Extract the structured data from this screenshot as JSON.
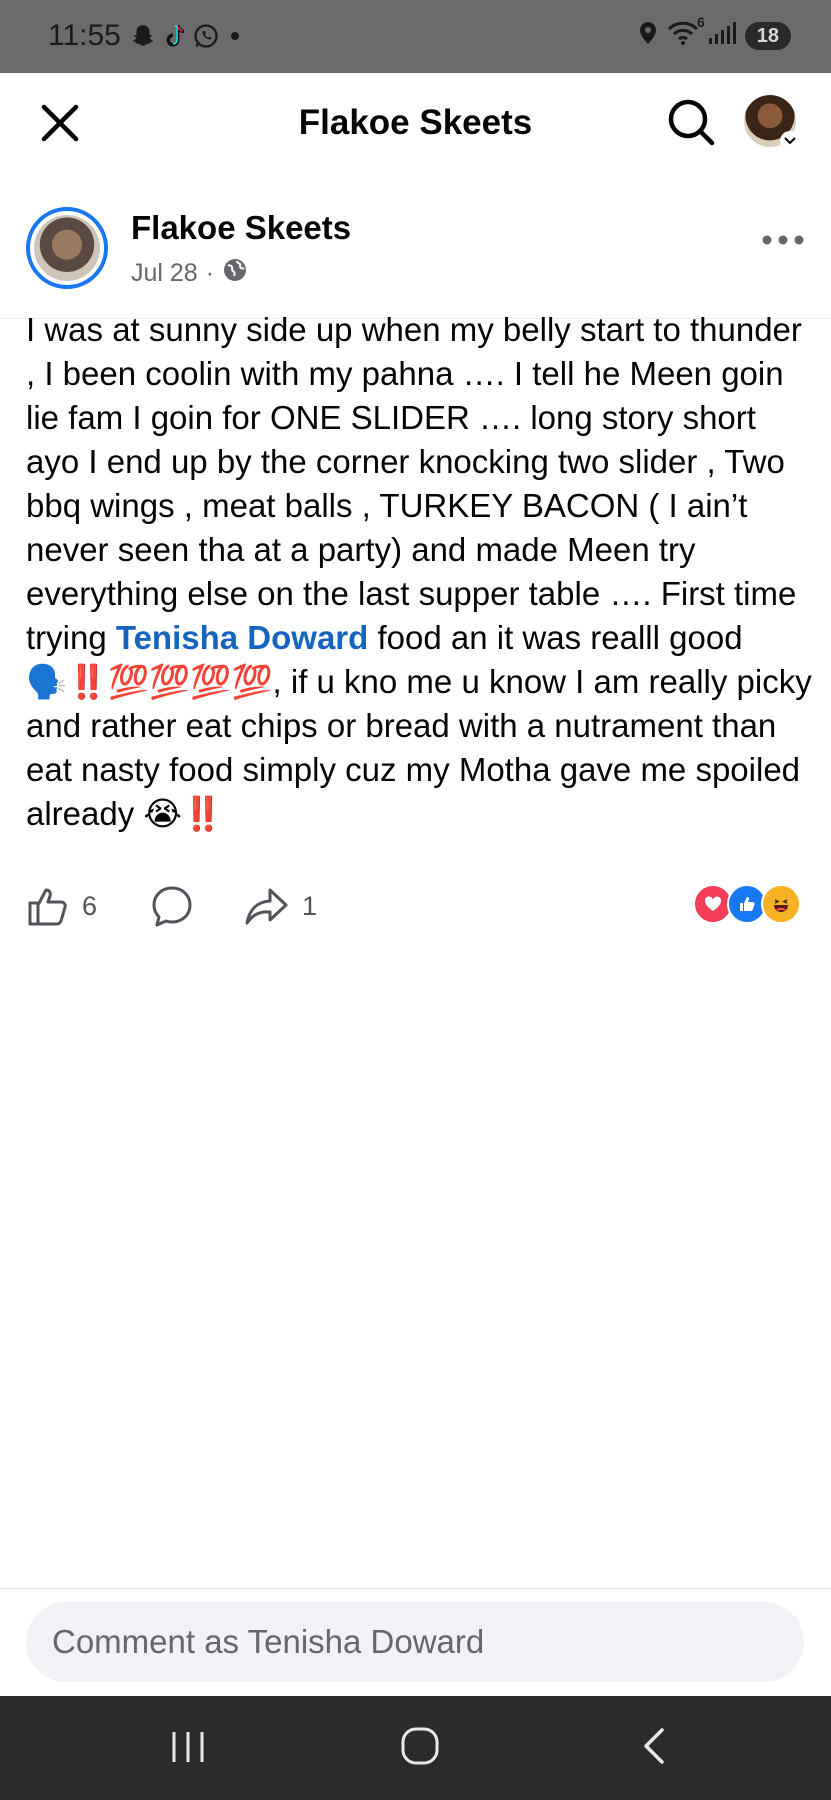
{
  "status_bar": {
    "time": "11:55",
    "notification_icons": [
      "snapchat-icon",
      "tiktok-icon",
      "whatsapp-icon",
      "dot-icon"
    ],
    "right_icons": [
      "location-icon",
      "wifi-icon",
      "signal-icon"
    ],
    "wifi_label": "6",
    "battery": "18"
  },
  "header": {
    "title": "Flakoe Skeets"
  },
  "post": {
    "author": "Flakoe Skeets",
    "date": "Jul 28",
    "separator": "·",
    "text_part1": "I was at sunny side up when my belly start to thunder , I been coolin with my pahna …. I tell he Meen goin lie fam I goin for ONE SLIDER …. long story short ayo I end up by the corner knocking two slider ,   Two bbq wings , meat balls , TURKEY BACON ( I ain’t never seen tha at a party) and made Meen try everything else on the last supper table …. First time trying ",
    "mention": "Tenisha Doward",
    "text_part2": " food an it was realll good 🗣️‼️💯💯💯💯, if u kno me u know I am really picky and rather eat chips or bread with a nutrament than eat nasty food simply cuz my Motha gave me spoiled already 😭‼️"
  },
  "actions": {
    "like_count": "6",
    "share_count": "1",
    "reactions": [
      "love",
      "like",
      "haha"
    ]
  },
  "comment": {
    "placeholder": "Comment as Tenisha Doward"
  },
  "colors": {
    "accent": "#1877f2",
    "mention": "#1565c0",
    "status_bar": "#6b6b6b",
    "nav_bar": "#2b2b2b"
  }
}
